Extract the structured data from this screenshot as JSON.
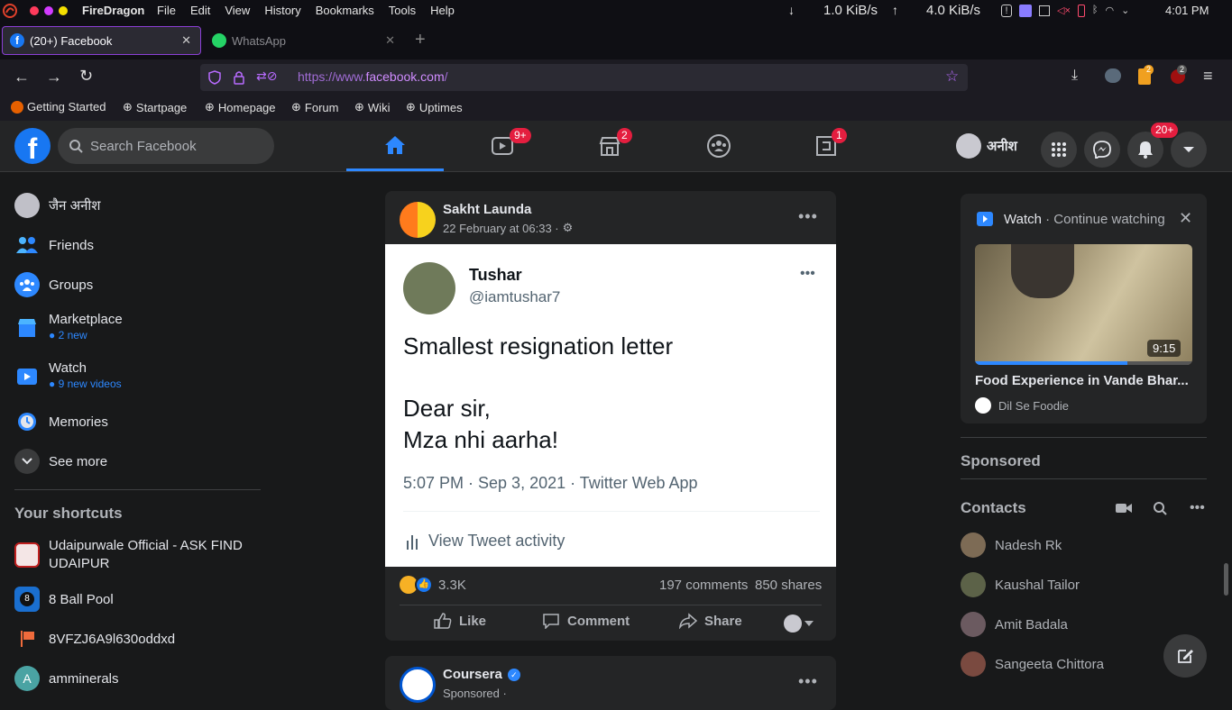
{
  "system": {
    "app_name": "FireDragon",
    "menu": [
      "File",
      "Edit",
      "View",
      "History",
      "Bookmarks",
      "Tools",
      "Help"
    ],
    "download_speed": "1.0 KiB/s",
    "upload_speed": "4.0 KiB/s",
    "time": "4:01 PM"
  },
  "tabs": [
    {
      "label": "(20+) Facebook"
    },
    {
      "label": "WhatsApp"
    }
  ],
  "url": {
    "prefix": "https://www.",
    "domain": "facebook.com",
    "suffix": "/"
  },
  "bookmarks": [
    "Getting Started",
    "Startpage",
    "Homepage",
    "Forum",
    "Wiki",
    "Uptimes"
  ],
  "extensions": {
    "badge1": "2",
    "badge2": "2"
  },
  "fb_header": {
    "search_placeholder": "Search Facebook",
    "watch_badge": "9+",
    "marketplace_badge": "2",
    "gaming_badge": "1",
    "profile_name": "अनीश",
    "notif_badge": "20+"
  },
  "left_nav": {
    "profile": "जैन अनीश",
    "friends": "Friends",
    "groups": "Groups",
    "marketplace": "Marketplace",
    "marketplace_sub": "2 new",
    "watch": "Watch",
    "watch_sub": "9 new videos",
    "memories": "Memories",
    "see_more": "See more",
    "shortcuts_title": "Your shortcuts",
    "shortcuts": [
      "Udaipurwale Official - ASK FIND UDAIPUR",
      "8 Ball Pool",
      "8VFZJ6A9l630oddxd",
      "amminerals"
    ]
  },
  "post": {
    "author": "Sakht Launda",
    "date": "22 February at 06:33 ·",
    "tweet_name": "Tushar",
    "tweet_handle": "@iamtushar7",
    "tweet_line1": "Smallest resignation letter",
    "tweet_line2": "Dear sir,",
    "tweet_line3": "Mza nhi aarha!",
    "tweet_meta": "5:07 PM · Sep 3, 2021 · Twitter Web App",
    "tweet_activity": "View Tweet activity",
    "reactions": "3.3K",
    "comments": "197 comments",
    "shares": "850 shares",
    "like": "Like",
    "comment": "Comment",
    "share": "Share"
  },
  "post2": {
    "author": "Coursera",
    "sub": "Sponsored ·"
  },
  "right": {
    "watch_label": "Watch",
    "watch_sub": "· Continue watching",
    "video_duration": "9:15",
    "video_progress": 0.7,
    "video_title": "Food Experience in Vande Bhar...",
    "channel": "Dil Se Foodie",
    "sponsored": "Sponsored",
    "contacts_title": "Contacts",
    "contacts": [
      "Nadesh Rk",
      "Kaushal Tailor",
      "Amit Badala",
      "Sangeeta Chittora"
    ]
  },
  "colors": {
    "accent": "#2d88ff",
    "badge": "#e41e3f",
    "fb_blue": "#1877f2"
  }
}
